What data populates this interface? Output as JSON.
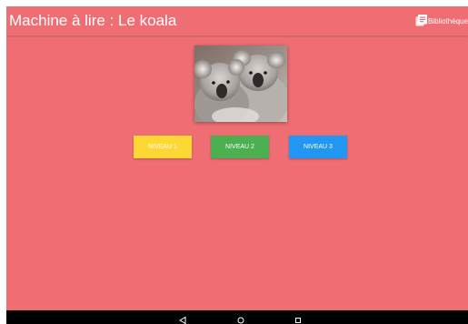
{
  "app_bar": {
    "title": "Machine à lire : Le koala",
    "library_label": "Bibliothèque",
    "library_icon": "library-book-icon"
  },
  "main": {
    "image_subject": "koala-photo",
    "levels": [
      {
        "label": "NIVEAU 1",
        "color": "#fdd835"
      },
      {
        "label": "NIVEAU 2",
        "color": "#4caf50"
      },
      {
        "label": "NIVEAU 3",
        "color": "#2196f3"
      }
    ]
  },
  "colors": {
    "background": "#ee6e73",
    "nav_bar": "#000000"
  },
  "nav_bar": {
    "icons": [
      "back-triangle-icon",
      "home-circle-icon",
      "recents-square-icon"
    ]
  }
}
